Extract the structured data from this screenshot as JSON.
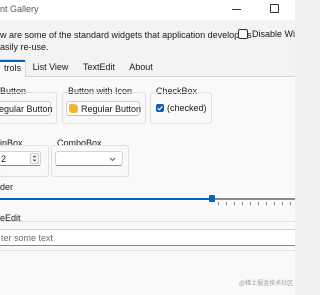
{
  "window": {
    "title": "nt Gallery"
  },
  "description": {
    "line1": "w are some of the standard widgets that application developers",
    "line2": "asily re-use."
  },
  "disable_widgets": {
    "label": "Disable Wid",
    "checked": false
  },
  "tabs": [
    {
      "label": "trols",
      "active": true
    },
    {
      "label": "List View",
      "active": false
    },
    {
      "label": "TextEdit",
      "active": false
    },
    {
      "label": "About",
      "active": false
    }
  ],
  "groups": {
    "button": {
      "title": "Button",
      "button_label": "egular Button"
    },
    "button_with_icon": {
      "title": "Button with Icon",
      "button_label": "Regular Button",
      "icon": "thumbs-up-icon"
    },
    "checkbox": {
      "title": "CheckBox",
      "label": "(checked)",
      "checked": true
    },
    "spinbox": {
      "title": "inBox",
      "value": "2"
    },
    "combobox": {
      "title": "ComboBox",
      "value": ""
    },
    "slider": {
      "title": "der",
      "level": 0.72
    },
    "lineedit": {
      "title": "eEdit",
      "placeholder": "ter some text"
    }
  },
  "colors": {
    "accent": "#0067c0",
    "checkbox": "#0f5bb5",
    "icon_thumb": "#f2b531"
  },
  "watermark": "@稀土掘金技术社区"
}
